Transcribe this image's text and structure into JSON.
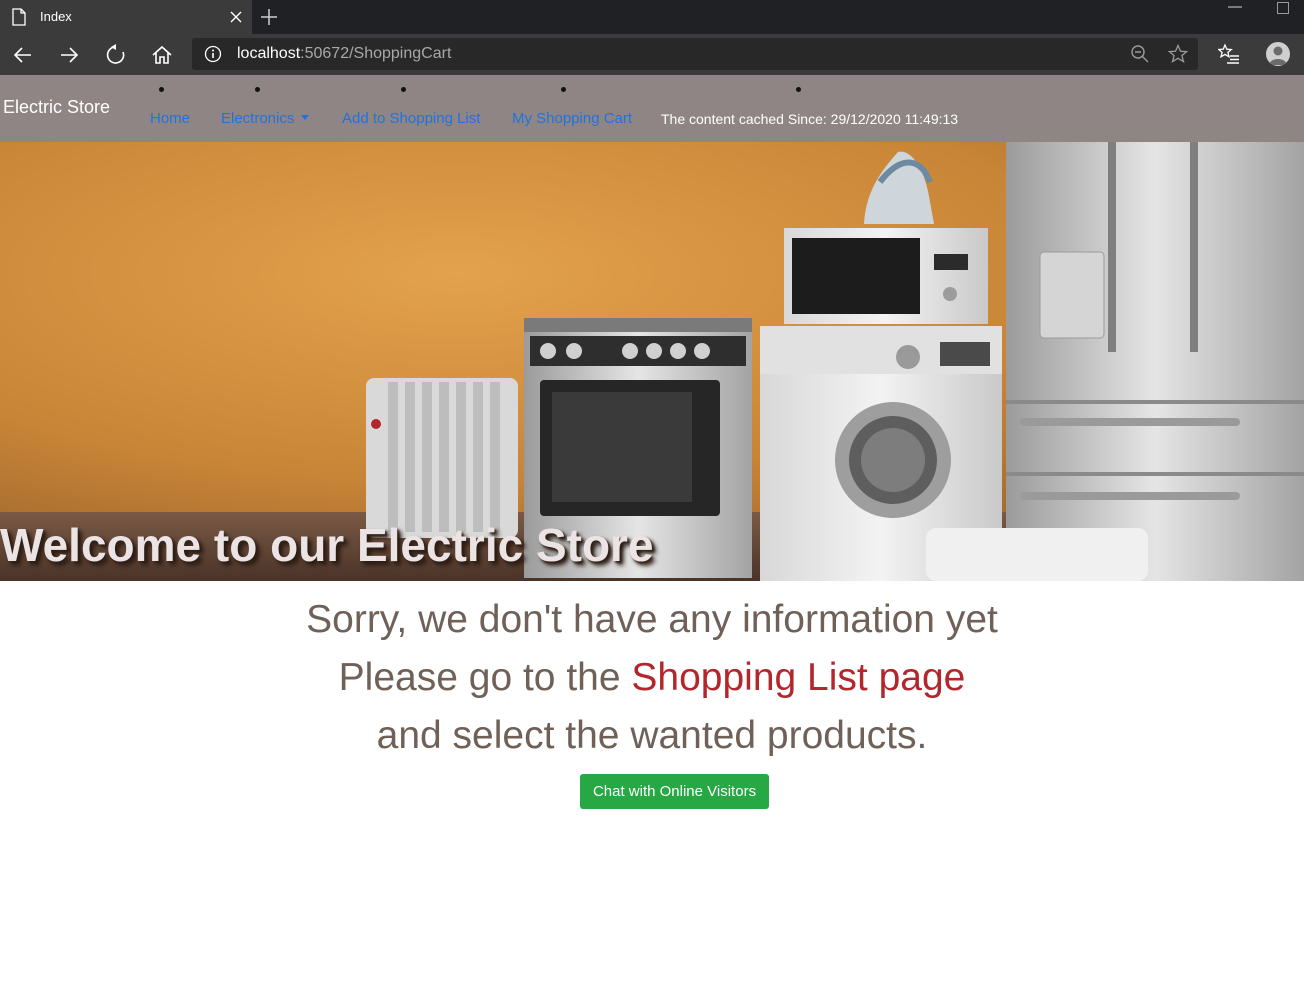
{
  "browser": {
    "tab_title": "Index",
    "url_host": "localhost",
    "url_rest": ":50672/ShoppingCart"
  },
  "navbar": {
    "brand": "Electric Store",
    "items": [
      {
        "label": "Home"
      },
      {
        "label": "Electronics",
        "has_dropdown": true
      },
      {
        "label": "Add to Shopping List"
      },
      {
        "label": "My Shopping Cart"
      }
    ],
    "cache_text": "The content cached Since: 29/12/2020 11:49:13"
  },
  "hero": {
    "title": "Welcome to our Electric Store"
  },
  "message": {
    "line1": "Sorry, we don't have any information yet",
    "line2_prefix": "Please go to the ",
    "line2_link": "Shopping List page",
    "line3": "and select the wanted products."
  },
  "chat_button": {
    "label": "Chat with Online Visitors"
  },
  "colors": {
    "navbar_bg": "#8f8585",
    "nav_link": "#1f73e0",
    "message_text": "#6f6158",
    "message_link": "#b3262b",
    "chat_button_bg": "#28a745"
  }
}
